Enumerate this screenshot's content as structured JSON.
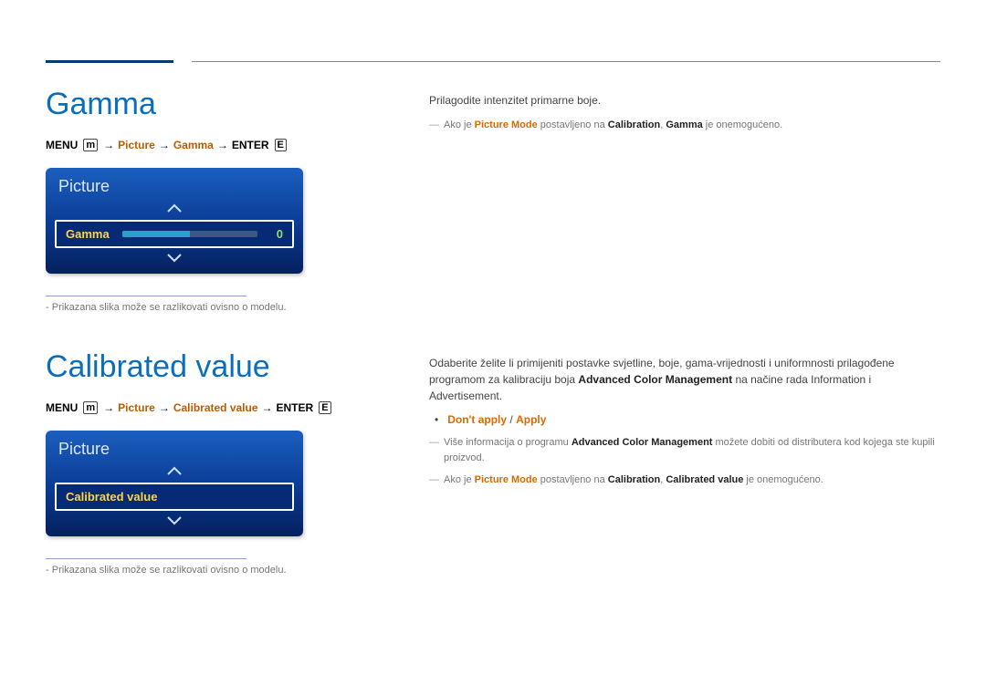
{
  "section1": {
    "heading": "Gamma",
    "menu_path": {
      "menu": "MENU",
      "p1": "Picture",
      "p2": "Gamma",
      "enter": "ENTER"
    },
    "osd": {
      "header": "Picture",
      "item_label": "Gamma",
      "item_value": "0"
    },
    "note": "Prikazana slika može se razlikovati ovisno o modelu.",
    "desc": "Prilagodite intenzitet primarne boje.",
    "info_prefix": "Ako je ",
    "info_pm": "Picture Mode",
    "info_mid1": " postavljeno na ",
    "info_cal": "Calibration",
    "info_mid2": ", ",
    "info_sub": "Gamma",
    "info_suffix": " je onemogućeno."
  },
  "section2": {
    "heading": "Calibrated value",
    "menu_path": {
      "menu": "MENU",
      "p1": "Picture",
      "p2": "Calibrated value",
      "enter": "ENTER"
    },
    "osd": {
      "header": "Picture",
      "item_label": "Calibrated value"
    },
    "note": "Prikazana slika može se razlikovati ovisno o modelu.",
    "desc_prefix": "Odaberite želite li primijeniti postavke svjetline, boje, gama-vrijednosti i uniformnosti prilagođene programom za kalibraciju boja ",
    "desc_acm": "Advanced Color Management",
    "desc_suffix": " na načine rada Information i Advertisement.",
    "opt_dont": "Don't apply",
    "opt_sep": " / ",
    "opt_apply": "Apply",
    "info1_prefix": "Više informacija o programu ",
    "info1_acm": "Advanced Color Management",
    "info1_suffix": " možete dobiti od distributera kod kojega ste kupili proizvod.",
    "info2_prefix": "Ako je ",
    "info2_pm": "Picture Mode",
    "info2_mid1": " postavljeno na ",
    "info2_cal": "Calibration",
    "info2_mid2": ", ",
    "info2_sub": "Calibrated value",
    "info2_suffix": " je onemogućeno."
  }
}
